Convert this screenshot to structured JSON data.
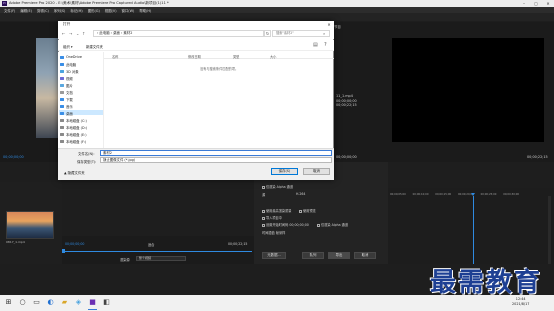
{
  "premiere": {
    "title": "Adobe Premiere Pro 2020 - E:\\美术\\素材\\Adobe Premiere Pro Captured Audio\\新项目(1)11 *",
    "menu": [
      "文件(F)",
      "编辑(E)",
      "剪辑(C)",
      "序列(S)",
      "标记(M)",
      "图形(G)",
      "视图(V)",
      "窗口(W)",
      "帮助(H)"
    ],
    "source_timecode": "00;00;00;00",
    "program_label": "节目",
    "program_overlay": [
      "11_1.mp4",
      "00;00;00;00",
      "00;00;22;15"
    ],
    "program_timecode_left": "00;00;00;00",
    "program_timecode_right": "00;00;22;15",
    "project_clip_label": "0817_1.mp4",
    "timeline": {
      "timecode_left": "00;00;00;00",
      "fit_label": "适合",
      "timecode_right": "00;00;22;15",
      "playback_label": "渲染源",
      "playback_value": "整个视频"
    },
    "export": {
      "use_previews": "仅渲染 Alpha 通道",
      "format_label": "源",
      "format_value": "H.264",
      "options": [
        "使用最高渲染质量",
        "使用预览",
        "导入项目中",
        "设置开始时间码",
        "仅渲染 Alpha 通道"
      ],
      "start_tc": "00;00;00;00",
      "time_interp_label": "时间插值",
      "time_interp_value": "帧采样",
      "buttons": {
        "metadata": "元数据...",
        "queue": "队列",
        "export": "导出",
        "cancel": "取消"
      }
    },
    "ruler": "00;00;05;00 00;00;10;00 00;00;15;00 00;00;20;00 00;00;25;00 00;00;30;00"
  },
  "watermark": "最需教育",
  "dialog": {
    "title": "打开",
    "close": "✕",
    "address": "› 此电脑 › 桌面 › 素材2",
    "search_placeholder": "搜索\"素材2\"",
    "organize": "组织 ▾",
    "new_folder": "新建文件夹",
    "columns": [
      "名称",
      "修改日期",
      "类型",
      "大小"
    ],
    "empty_message": "没有与搜索条件匹配的项。",
    "sidebar": [
      {
        "label": "OneDrive",
        "color": "#3a8ee6"
      },
      {
        "label": "此电脑",
        "color": "#3a8ee6"
      },
      {
        "label": "3D 对象",
        "color": "#4aa3df"
      },
      {
        "label": "视频",
        "color": "#6b6bd6"
      },
      {
        "label": "图片",
        "color": "#5aa8e0"
      },
      {
        "label": "文档",
        "color": "#9a9a9a"
      },
      {
        "label": "下载",
        "color": "#3a8ee6"
      },
      {
        "label": "音乐",
        "color": "#3a8ee6"
      },
      {
        "label": "桌面",
        "color": "#3a8ee6"
      },
      {
        "label": "本地磁盘 (C:)",
        "color": "#8a8a8a"
      },
      {
        "label": "本地磁盘 (D:)",
        "color": "#8a8a8a"
      },
      {
        "label": "本地磁盘 (E:)",
        "color": "#8a8a8a"
      },
      {
        "label": "本地磁盘 (F:)",
        "color": "#8a8a8a"
      }
    ],
    "selected_index": 8,
    "filename_label": "文件名(N):",
    "filename_value": "素材2",
    "filetype_label": "保存类型(T):",
    "filetype_value": "静止图像文件 (*.jpg)",
    "open_button": "保存(S)",
    "cancel_button": "取消",
    "hide_folders": "▲ 隐藏文件夹"
  },
  "taskbar": {
    "time": "12:44",
    "date": "2021/8/17"
  }
}
